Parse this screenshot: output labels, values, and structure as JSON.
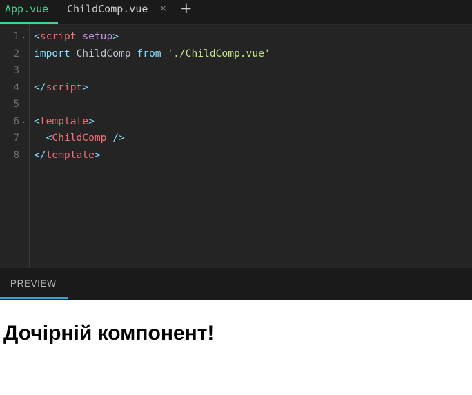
{
  "tabs": [
    {
      "label": "App.vue",
      "active": true
    },
    {
      "label": "ChildComp.vue",
      "active": false,
      "closable": true
    }
  ],
  "tab_close_glyph": "×",
  "add_tab_glyph": "+",
  "line_numbers": [
    "1",
    "2",
    "3",
    "4",
    "5",
    "6",
    "7",
    "8"
  ],
  "fold_glyph": "⌄",
  "code": {
    "l1_open": "<",
    "l1_tag": "script",
    "l1_space": " ",
    "l1_attr": "setup",
    "l1_close": ">",
    "l2_kw1": "import",
    "l2_ident": " ChildComp ",
    "l2_kw2": "from",
    "l2_space": " ",
    "l2_str": "'./ChildComp.vue'",
    "l4_open": "</",
    "l4_tag": "script",
    "l4_close": ">",
    "l6_open": "<",
    "l6_tag": "template",
    "l6_close": ">",
    "l7_indent": "  ",
    "l7_open": "<",
    "l7_tag": "ChildComp",
    "l7_close": " />",
    "l8_open": "</",
    "l8_tag": "template",
    "l8_close": ">"
  },
  "preview": {
    "tab_label": "PREVIEW",
    "heading": "Дочірній компонент!"
  },
  "colors": {
    "accent_green": "#42d392",
    "preview_accent": "#2ea7dc",
    "editor_bg": "#242424"
  }
}
